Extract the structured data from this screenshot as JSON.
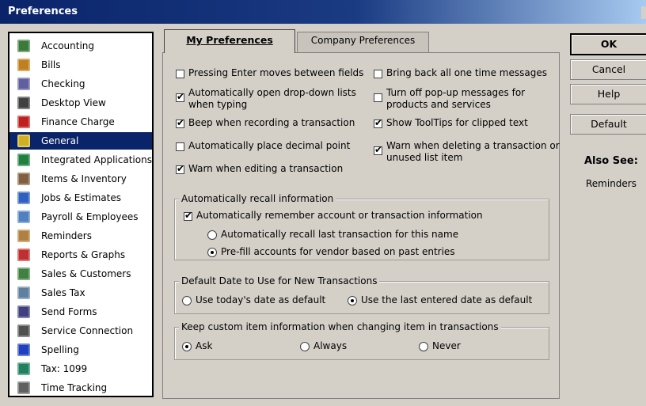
{
  "window": {
    "title": "Preferences"
  },
  "sidebar": {
    "items": [
      {
        "label": "Accounting",
        "icon": "accounting-icon",
        "color": "#3a7a3a"
      },
      {
        "label": "Bills",
        "icon": "bills-icon",
        "color": "#c08020"
      },
      {
        "label": "Checking",
        "icon": "checking-icon",
        "color": "#6060a0"
      },
      {
        "label": "Desktop View",
        "icon": "desktop-view-icon",
        "color": "#404040"
      },
      {
        "label": "Finance Charge",
        "icon": "finance-charge-icon",
        "color": "#c02020"
      },
      {
        "label": "General",
        "icon": "general-icon",
        "color": "#d0b020"
      },
      {
        "label": "Integrated Applications",
        "icon": "integrated-applications-icon",
        "color": "#208040"
      },
      {
        "label": "Items & Inventory",
        "icon": "items-inventory-icon",
        "color": "#806040"
      },
      {
        "label": "Jobs & Estimates",
        "icon": "jobs-estimates-icon",
        "color": "#3060c0"
      },
      {
        "label": "Payroll & Employees",
        "icon": "payroll-employees-icon",
        "color": "#5080c0"
      },
      {
        "label": "Reminders",
        "icon": "reminders-icon",
        "color": "#b08040"
      },
      {
        "label": "Reports & Graphs",
        "icon": "reports-graphs-icon",
        "color": "#c03030"
      },
      {
        "label": "Sales & Customers",
        "icon": "sales-customers-icon",
        "color": "#408040"
      },
      {
        "label": "Sales Tax",
        "icon": "sales-tax-icon",
        "color": "#6080a0"
      },
      {
        "label": "Send Forms",
        "icon": "send-forms-icon",
        "color": "#404080"
      },
      {
        "label": "Service Connection",
        "icon": "service-connection-icon",
        "color": "#505050"
      },
      {
        "label": "Spelling",
        "icon": "spelling-icon",
        "color": "#2040c0"
      },
      {
        "label": "Tax: 1099",
        "icon": "tax-1099-icon",
        "color": "#208060"
      },
      {
        "label": "Time Tracking",
        "icon": "time-tracking-icon",
        "color": "#606060"
      }
    ],
    "selected": "General",
    "selected_color": "#0a246a"
  },
  "tabs": {
    "my": "My Preferences",
    "company": "Company Preferences"
  },
  "options": {
    "enter_moves": {
      "label": "Pressing Enter moves between fields",
      "checked": false
    },
    "auto_dropdown": {
      "label": "Automatically open drop-down lists",
      "label2": "when typing",
      "checked": true
    },
    "beep": {
      "label": "Beep when recording a transaction",
      "checked": true
    },
    "decimal": {
      "label": "Automatically place decimal point",
      "checked": false
    },
    "warn_edit": {
      "label": "Warn when editing a transaction",
      "checked": true
    },
    "bring_back": {
      "label": "Bring back all one time messages",
      "checked": false
    },
    "turn_off_popups": {
      "label": "Turn off pop-up messages for",
      "label2": "products and services",
      "checked": false
    },
    "tooltips": {
      "label": "Show ToolTips for clipped text",
      "checked": true
    },
    "warn_delete": {
      "label": "Warn when deleting a transaction or",
      "label2": "unused list item",
      "checked": true
    }
  },
  "recall": {
    "title": "Automatically recall information",
    "remember": {
      "label": "Automatically remember account or transaction information",
      "checked": true
    },
    "recall_last": {
      "label": "Automatically recall last transaction for this name",
      "selected": false
    },
    "prefill": {
      "label": "Pre-fill accounts for vendor based on past entries",
      "selected": true
    }
  },
  "default_date": {
    "title": "Default Date to Use for New Transactions",
    "today": {
      "label": "Use today's date as default",
      "selected": false
    },
    "last": {
      "label": "Use the last entered date as default",
      "selected": true
    }
  },
  "custom_item": {
    "title": "Keep custom item information when changing item in transactions",
    "ask": {
      "label": "Ask",
      "selected": true
    },
    "always": {
      "label": "Always",
      "selected": false
    },
    "never": {
      "label": "Never",
      "selected": false
    }
  },
  "buttons": {
    "ok": "OK",
    "cancel": "Cancel",
    "help": "Help",
    "default": "Default"
  },
  "also_see": {
    "title": "Also See:",
    "link": "Reminders"
  }
}
